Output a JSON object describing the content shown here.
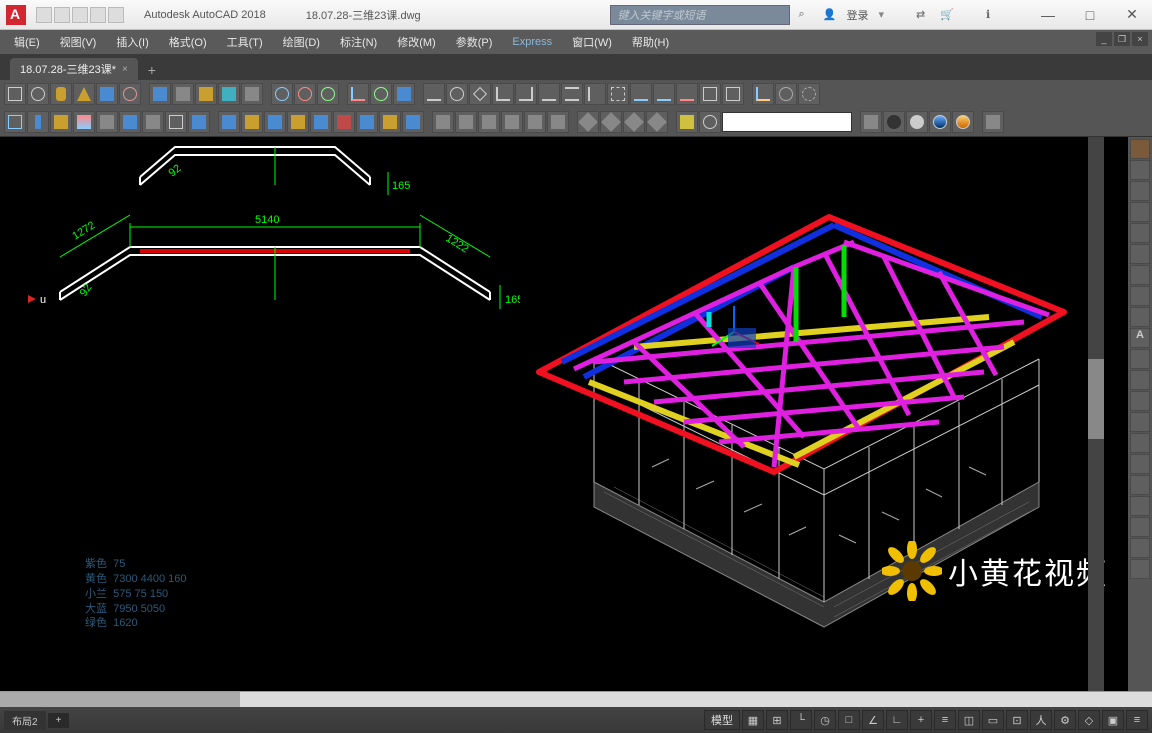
{
  "title": {
    "app": "Autodesk AutoCAD 2018",
    "file": "18.07.28-三维23课.dwg"
  },
  "search": {
    "placeholder": "键入关键字或短语"
  },
  "login": {
    "label": "登录"
  },
  "window_controls": {
    "min": "—",
    "max": "□",
    "close": "✕"
  },
  "menus": [
    "辑(E)",
    "视图(V)",
    "插入(I)",
    "格式(O)",
    "工具(T)",
    "绘图(D)",
    "标注(N)",
    "修改(M)",
    "参数(P)",
    "Express",
    "窗口(W)",
    "帮助(H)"
  ],
  "filetab": {
    "name": "18.07.28-三维23课*",
    "plus": "+"
  },
  "annotations": [
    {
      "label": "紫色",
      "value": "75"
    },
    {
      "label": "黄色",
      "value": "7300 4400 160"
    },
    {
      "label": "小兰",
      "value": "575 75 150"
    },
    {
      "label": "大蓝",
      "value": "7950 5050"
    },
    {
      "label": "绿色",
      "value": "1620"
    }
  ],
  "dimensions_top": {
    "span": "5140",
    "left_slope": "1272",
    "right_slope": "1222",
    "drop_l": "165",
    "drop_r": "165"
  },
  "layout_tabs": {
    "model": "模型",
    "layout": "布局2",
    "plus": "+"
  },
  "watermark": "小黄花视频",
  "icons": {
    "search": "⌕",
    "login": "👤",
    "cart": "🛒",
    "info": "ℹ",
    "exchange": "⇄"
  }
}
